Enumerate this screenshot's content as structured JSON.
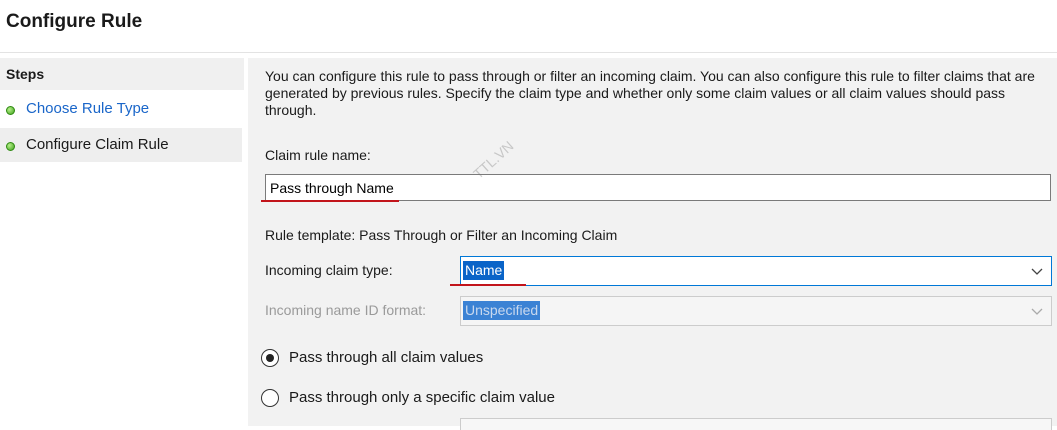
{
  "header": {
    "title": "Configure Rule"
  },
  "steps": {
    "heading": "Steps",
    "items": [
      {
        "label": "Choose Rule Type",
        "state": "link"
      },
      {
        "label": "Configure Claim Rule",
        "state": "current"
      }
    ]
  },
  "main": {
    "description": "You can configure this rule to pass through or filter an incoming claim. You can also configure this rule to filter claims that are generated by previous rules. Specify the claim type and whether only some claim values or all claim values should pass through.",
    "claim_rule_name_label": "Claim rule name:",
    "claim_rule_name_value": "Pass through Name",
    "rule_template": "Rule template: Pass Through or Filter an Incoming Claim",
    "incoming_claim_type_label": "Incoming claim type:",
    "incoming_claim_type_value": "Name",
    "incoming_name_id_format_label": "Incoming name ID format:",
    "incoming_name_id_format_value": "Unspecified",
    "radio_all": "Pass through all claim values",
    "radio_specific": "Pass through only a specific claim value",
    "selected_radio": "all"
  },
  "watermark": "TTL.VN",
  "colors": {
    "link": "#1a66c9",
    "selection": "#0a64c8",
    "annotation_underline": "#c2141b",
    "step_dot": "#3ea11c"
  }
}
